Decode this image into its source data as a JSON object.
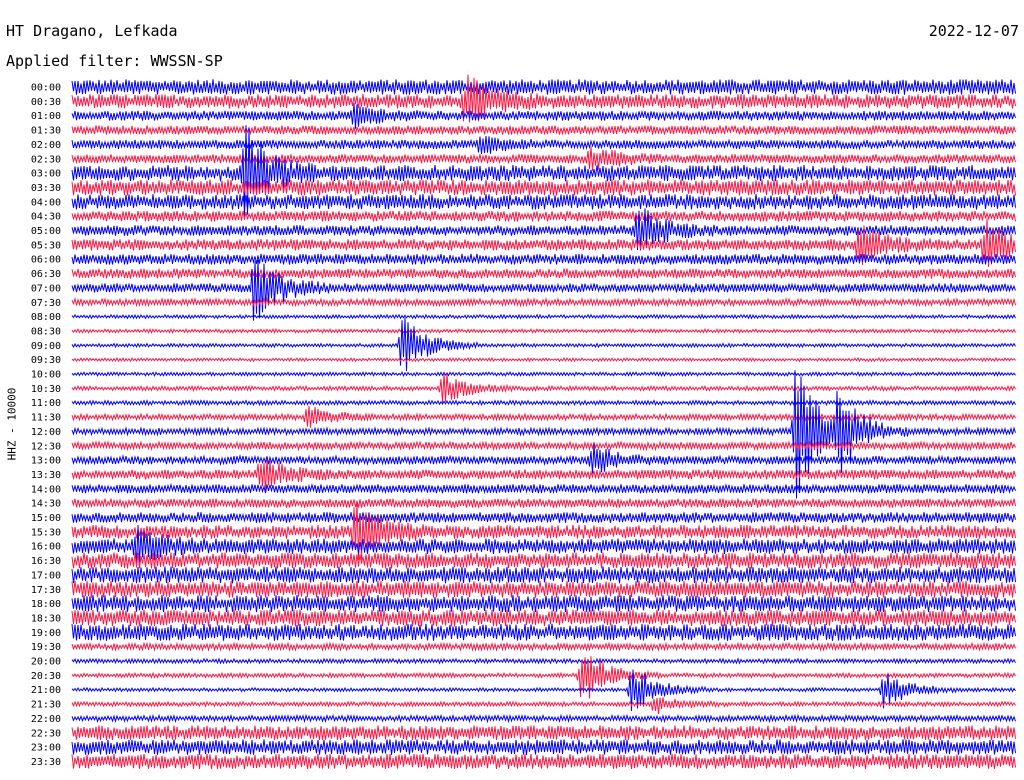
{
  "header": {
    "station": "HT Dragano, Lefkada",
    "date": "2022-12-07",
    "filter": "Applied filter: WWSSN-SP"
  },
  "axis": {
    "ylabel": "HHZ - 10000"
  },
  "colors": {
    "odd_trace": "#0000ff",
    "even_trace": "#ff1744",
    "background": "#ffffff"
  },
  "chart_data": {
    "type": "helicorder",
    "trace_minutes": 30,
    "trace_colors_alternate": [
      "blue",
      "red"
    ],
    "time_labels": [
      "00:00",
      "00:30",
      "01:00",
      "01:30",
      "02:00",
      "02:30",
      "03:00",
      "03:30",
      "04:00",
      "04:30",
      "05:00",
      "05:30",
      "06:00",
      "06:30",
      "07:00",
      "07:30",
      "08:00",
      "08:30",
      "09:00",
      "09:30",
      "10:00",
      "10:30",
      "11:00",
      "11:30",
      "12:00",
      "12:30",
      "13:00",
      "13:30",
      "14:00",
      "14:30",
      "15:00",
      "15:30",
      "16:00",
      "16:30",
      "17:00",
      "17:30",
      "18:00",
      "18:30",
      "19:00",
      "19:30",
      "20:00",
      "20:30",
      "21:00",
      "21:30",
      "22:00",
      "22:30",
      "23:00",
      "23:30"
    ],
    "noise_level": [
      0.9,
      0.85,
      0.55,
      0.5,
      0.5,
      0.5,
      0.95,
      0.95,
      0.9,
      0.6,
      0.6,
      0.65,
      0.6,
      0.55,
      0.5,
      0.35,
      0.15,
      0.15,
      0.15,
      0.12,
      0.15,
      0.2,
      0.2,
      0.3,
      0.35,
      0.4,
      0.45,
      0.55,
      0.5,
      0.5,
      0.6,
      0.8,
      0.9,
      0.95,
      1.0,
      1.0,
      1.0,
      1.0,
      1.0,
      0.35,
      0.2,
      0.2,
      0.15,
      0.2,
      0.3,
      0.85,
      0.9,
      0.9
    ],
    "events": [
      {
        "time": "00:30",
        "minute": 12.5,
        "amplitude": 1.2
      },
      {
        "time": "01:00",
        "minute": 9,
        "amplitude": 0.5
      },
      {
        "time": "02:00",
        "minute": 13,
        "amplitude": 0.4
      },
      {
        "time": "02:30",
        "minute": 16.5,
        "amplitude": 0.6
      },
      {
        "time": "03:00",
        "minute": 5.5,
        "amplitude": 2.2
      },
      {
        "time": "05:00",
        "minute": 18,
        "amplitude": 1.2
      },
      {
        "time": "05:30",
        "minute": 25,
        "amplitude": 0.9
      },
      {
        "time": "05:30",
        "minute": 29,
        "amplitude": 1.2
      },
      {
        "time": "07:00",
        "minute": 5.8,
        "amplitude": 1.8
      },
      {
        "time": "09:00",
        "minute": 10.5,
        "amplitude": 1.6
      },
      {
        "time": "10:30",
        "minute": 11.8,
        "amplitude": 0.8
      },
      {
        "time": "11:30",
        "minute": 7.5,
        "amplitude": 0.6
      },
      {
        "time": "12:00",
        "minute": 23,
        "amplitude": 3.5
      },
      {
        "time": "12:00",
        "minute": 24.3,
        "amplitude": 2.5
      },
      {
        "time": "13:00",
        "minute": 16.5,
        "amplitude": 0.8
      },
      {
        "time": "13:30",
        "minute": 6,
        "amplitude": 0.8
      },
      {
        "time": "15:30",
        "minute": 9,
        "amplitude": 1.5
      },
      {
        "time": "16:00",
        "minute": 2,
        "amplitude": 0.8
      },
      {
        "time": "20:30",
        "minute": 16.2,
        "amplitude": 1.5
      },
      {
        "time": "21:00",
        "minute": 17.8,
        "amplitude": 1.3
      },
      {
        "time": "21:00",
        "minute": 25.8,
        "amplitude": 1.0
      },
      {
        "time": "21:30",
        "minute": 18.5,
        "amplitude": 0.5
      }
    ]
  }
}
